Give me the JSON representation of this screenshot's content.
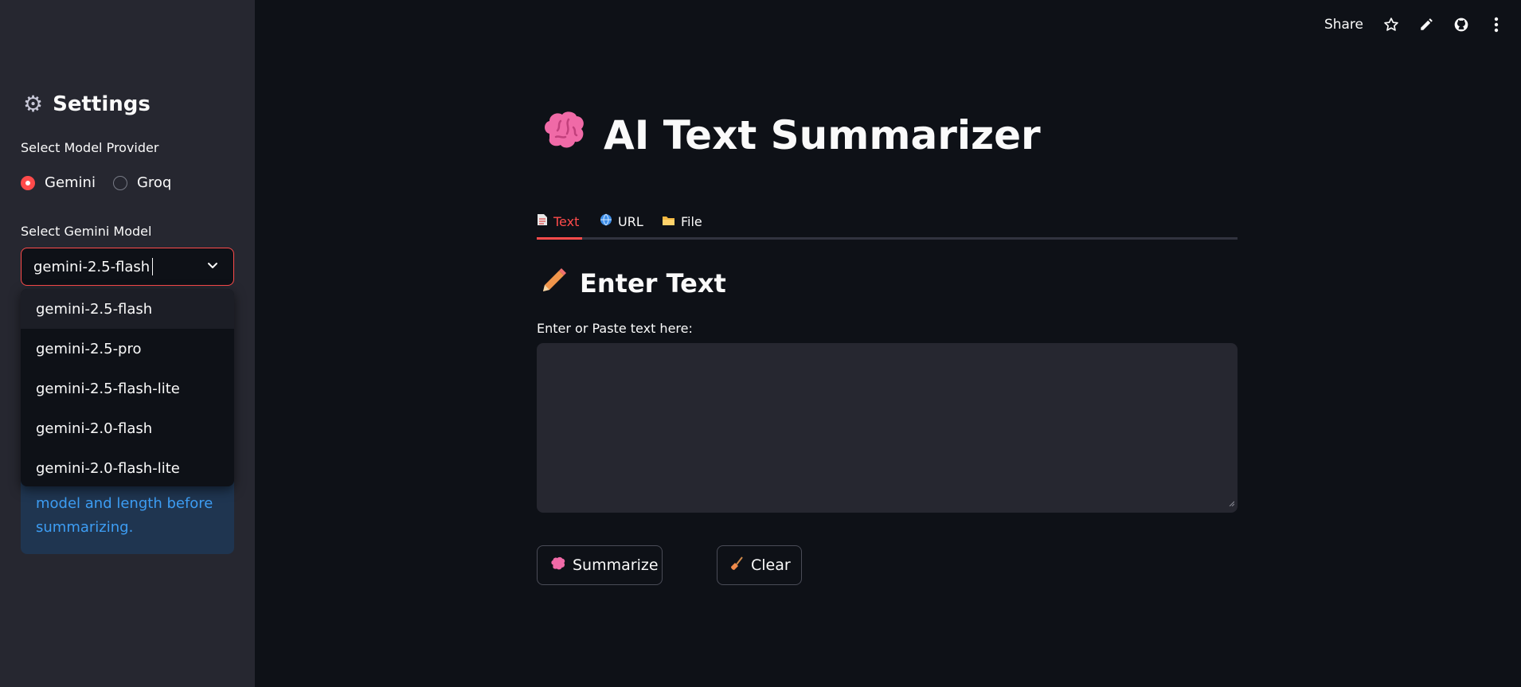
{
  "header": {
    "share_label": "Share",
    "icons": [
      "star-icon",
      "pencil-icon",
      "github-icon",
      "more-vert-icon"
    ]
  },
  "sidebar": {
    "title": "Settings",
    "title_icon": "gear-icon",
    "provider_label": "Select Model Provider",
    "providers": [
      {
        "label": "Gemini",
        "selected": true
      },
      {
        "label": "Groq",
        "selected": false
      }
    ],
    "model_label": "Select Gemini Model",
    "model_value": "gemini-2.5-flash",
    "model_options": [
      "gemini-2.5-flash",
      "gemini-2.5-pro",
      "gemini-2.5-flash-lite",
      "gemini-2.0-flash",
      "gemini-2.0-flash-lite"
    ],
    "info_text": "model and length before summarizing."
  },
  "main": {
    "title": "AI Text Summarizer",
    "title_icon": "brain-icon",
    "tabs": [
      {
        "label": "Text",
        "icon": "document-icon",
        "active": true
      },
      {
        "label": "URL",
        "icon": "globe-icon",
        "active": false
      },
      {
        "label": "File",
        "icon": "folder-icon",
        "active": false
      }
    ],
    "section_title": "Enter Text",
    "section_icon": "pencil-icon",
    "textarea_label": "Enter or Paste text here:",
    "textarea_value": "",
    "summarize_label": "Summarize",
    "clear_label": "Clear"
  },
  "colors": {
    "accent": "#ff4b4b",
    "background": "#0e1117",
    "sidebar": "#262730",
    "info_text": "#3d9df3"
  }
}
